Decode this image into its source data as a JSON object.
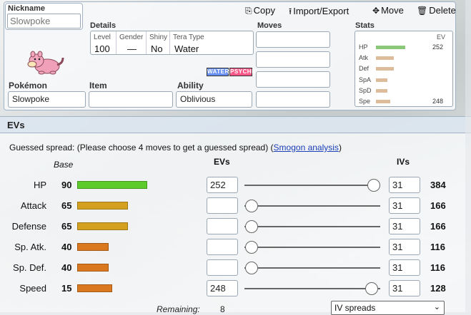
{
  "toolbar": {
    "copy": "Copy",
    "import_export": "Import/Export",
    "move": "Move",
    "delete": "Delete"
  },
  "set": {
    "nickname_label": "Nickname",
    "nickname_placeholder": "Slowpoke",
    "details_label": "Details",
    "details": {
      "level_h": "Level",
      "level": "100",
      "gender_h": "Gender",
      "gender": "—",
      "shiny_h": "Shiny",
      "shiny": "No",
      "tera_h": "Tera Type",
      "tera": "Water"
    },
    "types": [
      {
        "name": "WATER",
        "color": "#6890f0"
      },
      {
        "name": "PSYCHIC",
        "color": "#f85888"
      }
    ],
    "pokemon_label": "Pokémon",
    "pokemon": "Slowpoke",
    "item_label": "Item",
    "item": "",
    "ability_label": "Ability",
    "ability": "Oblivious",
    "moves_label": "Moves",
    "moves": [
      "",
      "",
      "",
      ""
    ],
    "stats_label": "Stats",
    "stats_ev_header": "EV",
    "stats": [
      {
        "name": "HP",
        "ev": "252",
        "bar": 0.68,
        "color": "#8bc87a"
      },
      {
        "name": "Atk",
        "ev": "",
        "bar": 0.42,
        "color": "#dcbc9a"
      },
      {
        "name": "Def",
        "ev": "",
        "bar": 0.42,
        "color": "#dcbc9a"
      },
      {
        "name": "SpA",
        "ev": "",
        "bar": 0.27,
        "color": "#dcbc9a"
      },
      {
        "name": "SpD",
        "ev": "",
        "bar": 0.27,
        "color": "#dcbc9a"
      },
      {
        "name": "Spe",
        "ev": "248",
        "bar": 0.34,
        "color": "#dcbc9a"
      }
    ]
  },
  "evs": {
    "title": "EVs",
    "guessed_prefix": "Guessed spread: (Please choose 4 moves to get a guessed spread) (",
    "smogon_link": "Smogon analysis",
    "guessed_suffix": ")",
    "col_base": "Base",
    "col_evs": "EVs",
    "col_ivs": "IVs",
    "rows": [
      {
        "stat": "HP",
        "base": "90",
        "ev": "252",
        "iv": "31",
        "total": "384",
        "slider": 1.0,
        "bar": 0.35,
        "color": "#5ecb2c"
      },
      {
        "stat": "Attack",
        "base": "65",
        "ev": "",
        "iv": "31",
        "total": "166",
        "slider": 0.0,
        "bar": 0.255,
        "color": "#d4a020"
      },
      {
        "stat": "Defense",
        "base": "65",
        "ev": "",
        "iv": "31",
        "total": "166",
        "slider": 0.0,
        "bar": 0.255,
        "color": "#d4a020"
      },
      {
        "stat": "Sp. Atk.",
        "base": "40",
        "ev": "",
        "iv": "31",
        "total": "116",
        "slider": 0.0,
        "bar": 0.157,
        "color": "#d9781e"
      },
      {
        "stat": "Sp. Def.",
        "base": "40",
        "ev": "",
        "iv": "31",
        "total": "116",
        "slider": 0.0,
        "bar": 0.157,
        "color": "#d9781e"
      },
      {
        "stat": "Speed",
        "base": "15",
        "ev": "248",
        "iv": "31",
        "total": "128",
        "slider": 0.984,
        "bar": 0.176,
        "color": "#d9781e"
      }
    ],
    "remaining_label": "Remaining:",
    "remaining": "8",
    "iv_select": "IV spreads"
  }
}
